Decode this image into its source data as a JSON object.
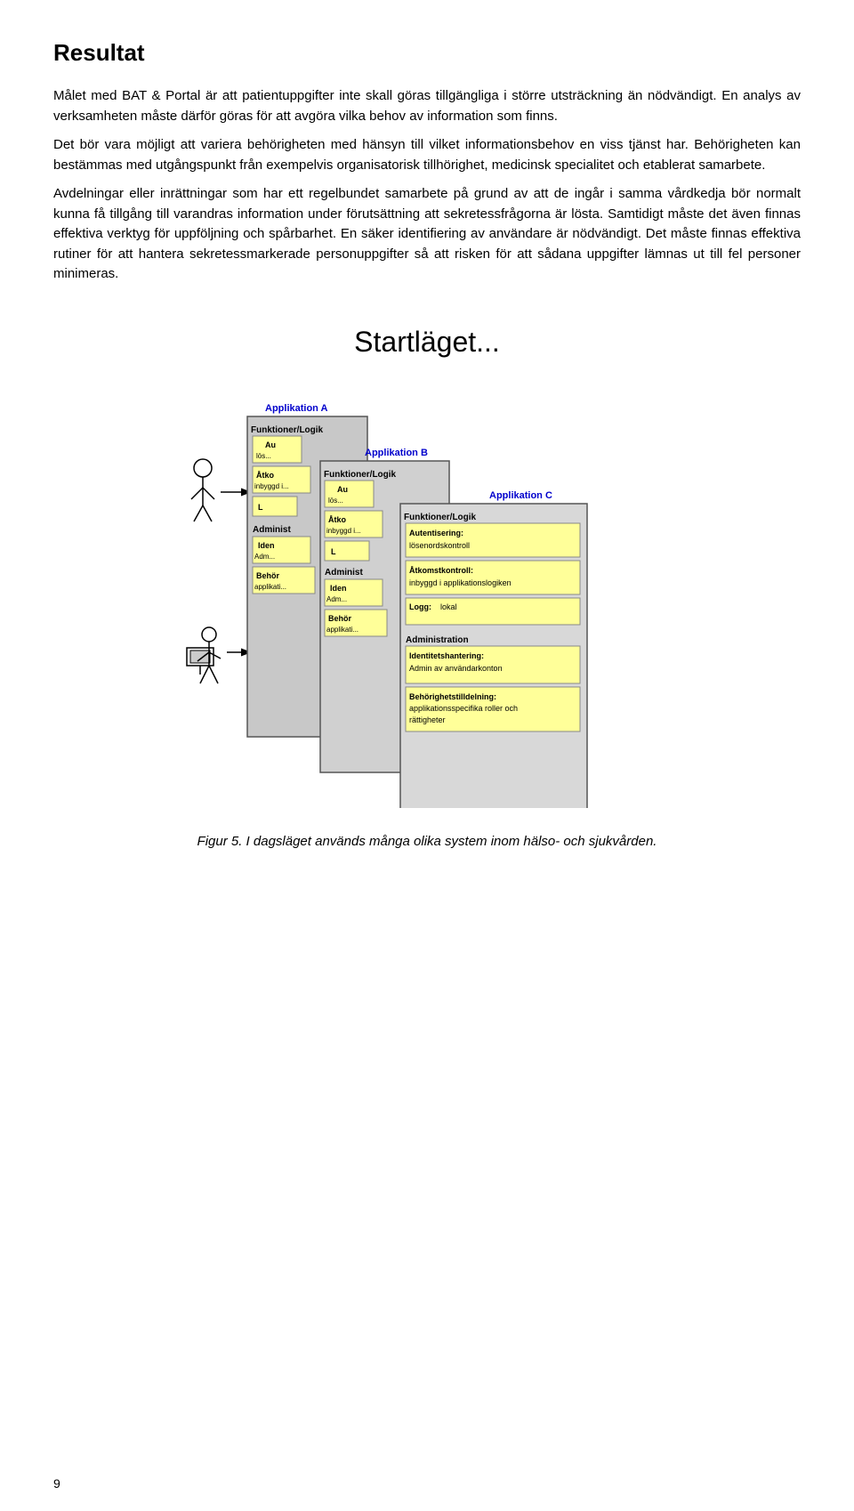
{
  "page": {
    "title": "Resultat",
    "paragraphs": [
      "Målet med BAT & Portal är att patientuppgifter inte skall göras tillgängliga i större utsträckning än nödvändigt. En analys av verksamheten måste därför göras för att avgöra vilka behov av information som finns.",
      "Det bör vara möjligt att variera behörigheten med hänsyn till vilket informationsbehov en viss tjänst har. Behörigheten kan bestämmas med utgångspunkt från exempelvis organisatorisk tillhörighet, medicinsk specialitet och etablerat samarbete.",
      "Avdelningar eller inrättningar som har ett regelbundet samarbete på grund av att de ingår i samma vårdkedja bör normalt kunna få tillgång till varandras information under förutsättning att sekretessfrågorna är lösta. Samtidigt måste det även finnas effektiva verktyg för uppföljning och spårbarhet. En säker identifiering av användare är nödvändigt. Det måste finnas effektiva rutiner för att hantera sekretessmarkerade personuppgifter så att risken för att sådana uppgifter lämnas ut till fel personer minimeras."
    ],
    "diagram": {
      "title": "Startläget...",
      "app_a_label": "Applikation A",
      "app_b_label": "Applikation B",
      "app_c_label": "Applikation C",
      "funktion_logik": "Funktioner/Logik",
      "boxes_a": [
        {
          "label": "Au",
          "sublabel": "lös"
        },
        {
          "label": "Åtko",
          "sublabel": "inbyggd i"
        },
        {
          "label": "L",
          "sublabel": ""
        }
      ],
      "admin_label": "Administ",
      "iden_a": {
        "label": "Iden",
        "sublabel": "Adm"
      },
      "behor_a": {
        "label": "Behör",
        "sublabel": "applikati"
      },
      "boxes_b": [
        {
          "label": "Au",
          "sublabel": "lös"
        },
        {
          "label": "Åtko",
          "sublabel": "inbyggd i"
        },
        {
          "label": "L",
          "sublabel": ""
        }
      ],
      "iden_b": {
        "label": "Iden",
        "sublabel": "Adm"
      },
      "behor_b": {
        "label": "Behör",
        "sublabel": "applikati"
      },
      "autentisering_c": {
        "title": "Autentisering:",
        "subtitle": "lösenordskontroll"
      },
      "atkomstkontroll_c": {
        "title": "Åtkomstkontroll:",
        "subtitle": "inbyggd i applikationslogiken"
      },
      "logg_c": {
        "title": "Logg:",
        "subtitle": "lokal"
      },
      "administration_c": "Administration",
      "identitetshantering_c": {
        "title": "Identitetshantering:",
        "subtitle": "Admin av användarkonton"
      },
      "behorighets_c": {
        "title": "Behörighetstilldelning:",
        "subtitle": "applikationsspecifika roller och rättigheter"
      }
    },
    "figure_caption": "Figur 5. I dagsläget används många olika system inom hälso- och sjukvården.",
    "page_number": "9"
  }
}
